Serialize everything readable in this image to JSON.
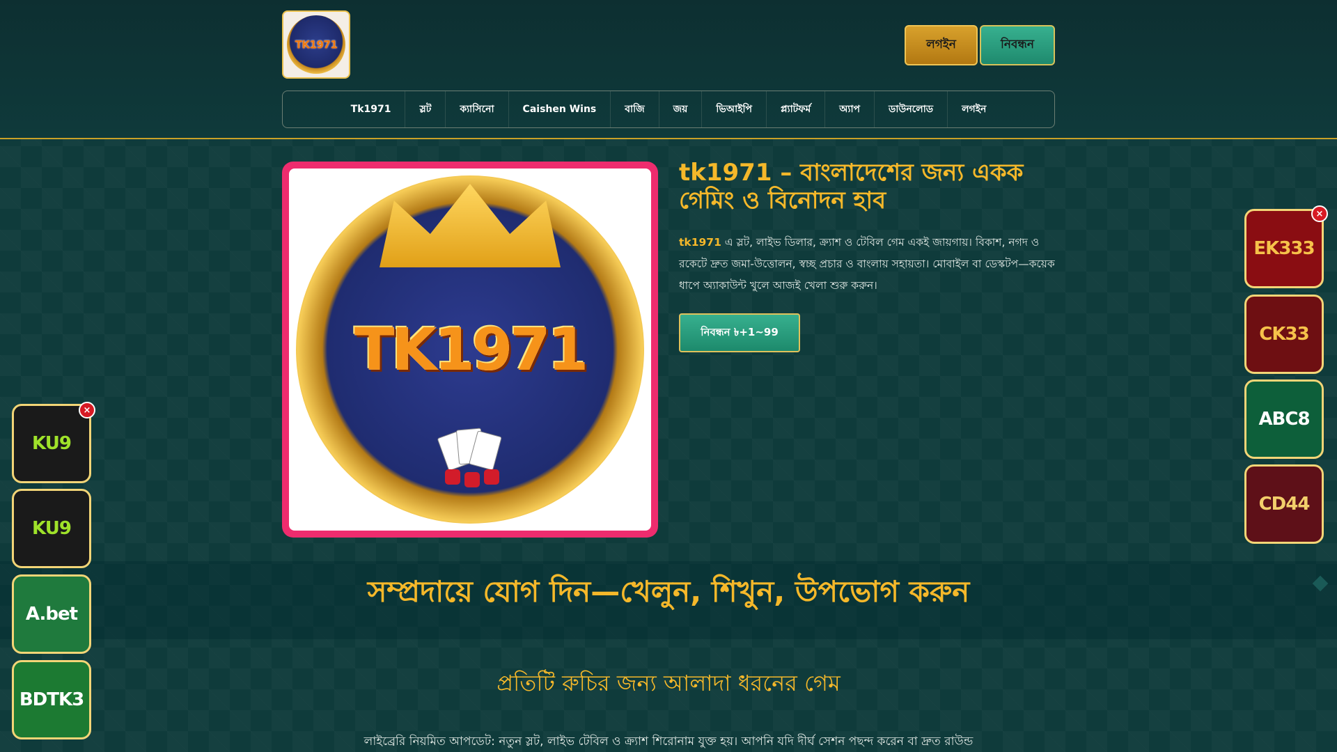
{
  "header": {
    "logo_text": "TK1971",
    "login_label": "লগইন",
    "register_label": "নিবন্ধন"
  },
  "nav": {
    "items": [
      "Tk1971",
      "স্লট",
      "ক্যাসিনো",
      "Caishen Wins",
      "বাজি",
      "জয়",
      "ভিআইপি",
      "প্ল্যাটফর্ম",
      "অ্যাপ",
      "ডাউনলোড",
      "লগইন"
    ]
  },
  "hero": {
    "image_brand": "TK1971",
    "title": "tk1971 – বাংলাদেশের জন্য একক গেমিং ও বিনোদন হাব",
    "desc_brand": "tk1971",
    "desc": " এ স্লট, লাইভ ডিলার, ক্র্যাশ ও টেবিল গেম একই জায়গায়। বিকাশ, নগদ ও রকেটে দ্রুত জমা-উত্তোলন, স্বচ্ছ প্রচার ও বাংলায় সহায়তা। মোবাইল বা ডেস্কটপ—কয়েক ধাপে অ্যাকাউন্ট খুলে আজই খেলা শুরু করুন।",
    "cta_label": "নিবন্ধন ৳+1~99"
  },
  "sections": {
    "community_title": "সম্প্রদায়ে যোগ দিন—খেলুন, শিখুন, উপভোগ করুন",
    "games_title": "প্রতিটি রুচির জন্য আলাদা ধরনের গেম",
    "games_text": "লাইব্রেরি নিয়মিত আপডেট: নতুন স্লট, লাইভ টেবিল ও ক্র্যাশ শিরোনাম যুক্ত হয়। আপনি যদি দীর্ঘ সেশন পছন্দ করেন বা দ্রুত রাউন্ড"
  },
  "left_ads": [
    {
      "label": "KU9",
      "bg": "#1a1a1a",
      "color": "#9fe22a"
    },
    {
      "label": "KU9",
      "bg": "#1a1a1a",
      "color": "#9fe22a"
    },
    {
      "label": "A.bet",
      "bg": "#1f7a3d",
      "color": "#ffffff"
    },
    {
      "label": "BDTK3",
      "bg": "#1c7a32",
      "color": "#ffffff"
    }
  ],
  "right_ads": [
    {
      "label": "EK333",
      "bg": "#8a0d12",
      "color": "#f6c24a"
    },
    {
      "label": "CK33",
      "bg": "#6e0f12",
      "color": "#f6c24a"
    },
    {
      "label": "ABC8",
      "bg": "#0d5f3a",
      "color": "#ffffff"
    },
    {
      "label": "CD44",
      "bg": "#5e1018",
      "color": "#f3cf6b"
    }
  ],
  "close_symbol": "×"
}
